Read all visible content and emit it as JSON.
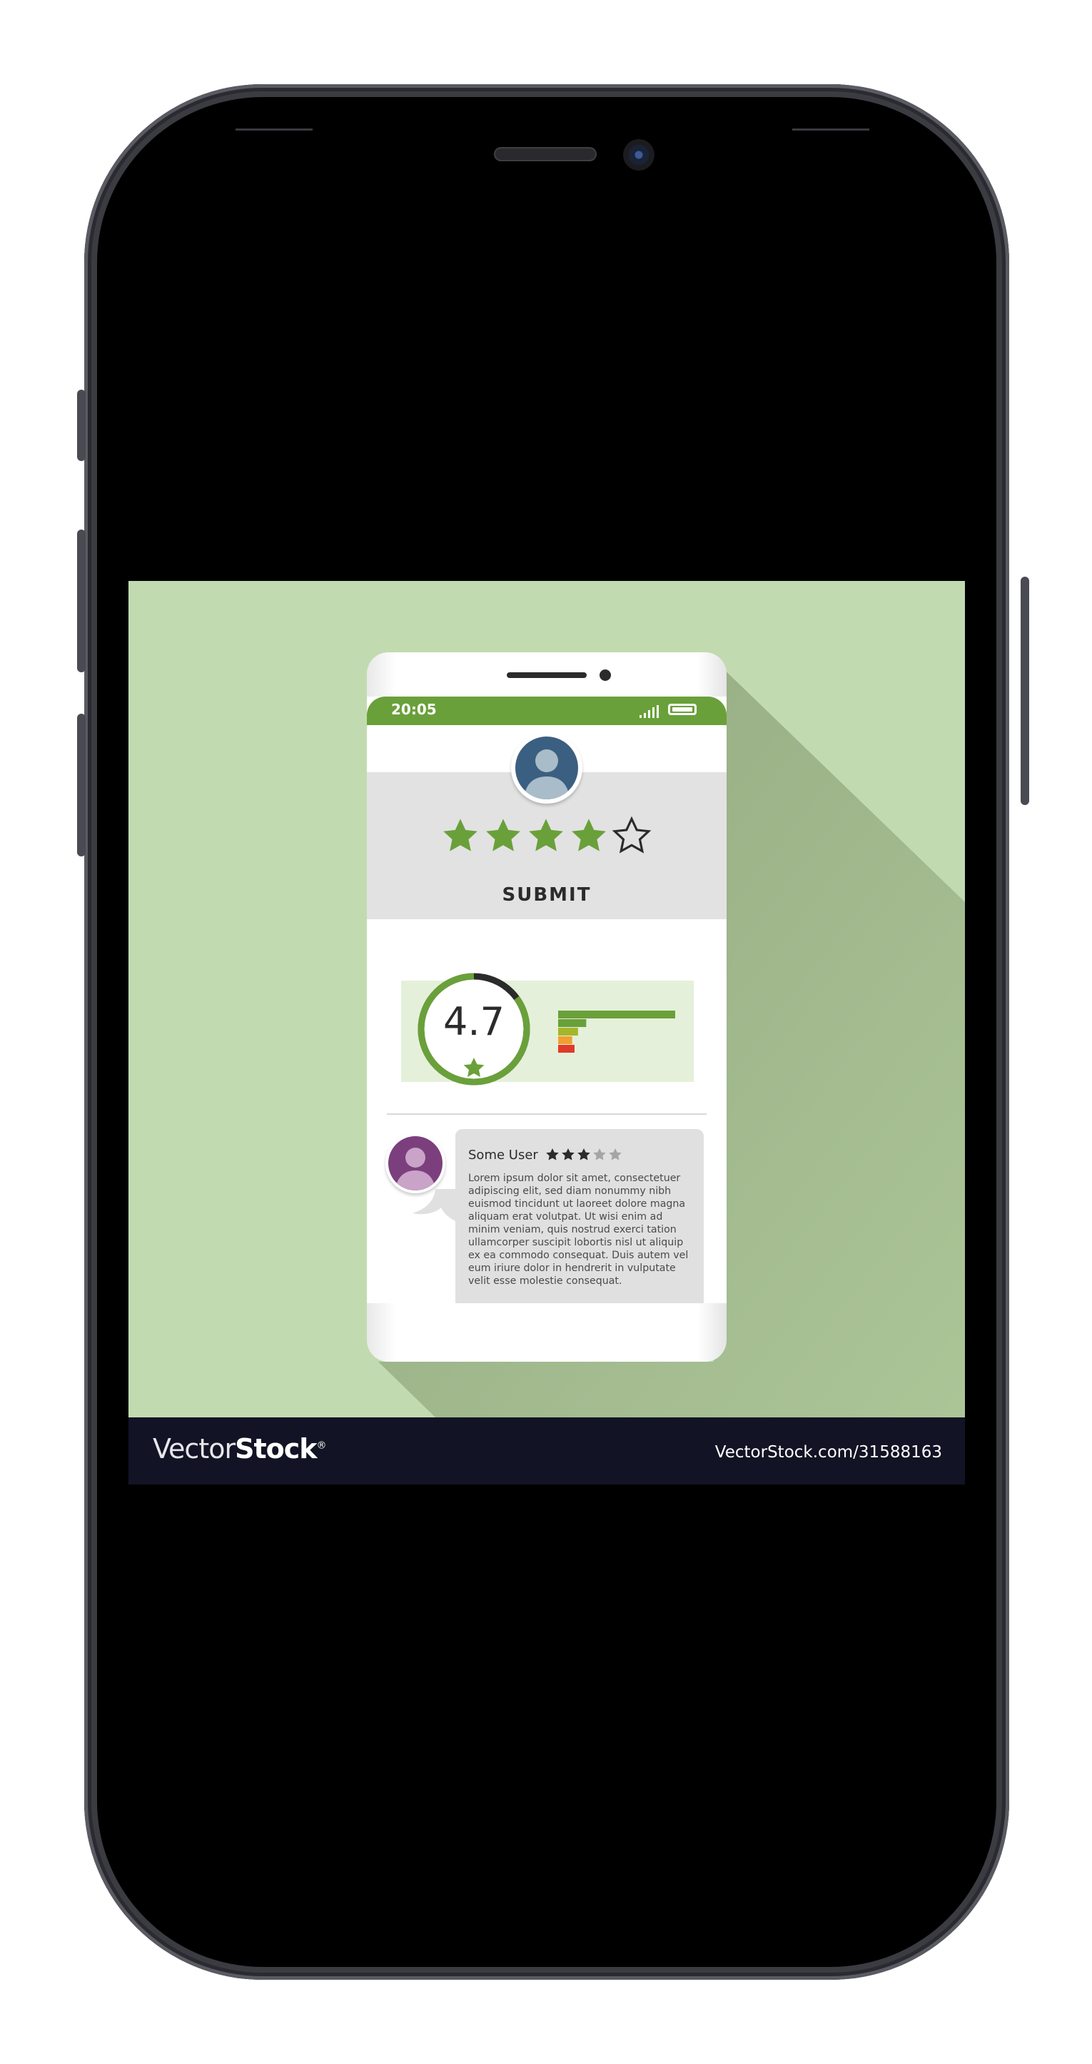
{
  "status_bar": {
    "time": "20:05"
  },
  "rating": {
    "selected_stars": 4,
    "max_stars": 5,
    "submit_label": "SUBMIT"
  },
  "score": {
    "value": "4.7",
    "ring_fraction": 0.85,
    "distribution": [
      {
        "stars": 5,
        "fraction": 1.0,
        "color": "#6aa03a"
      },
      {
        "stars": 4,
        "fraction": 0.24,
        "color": "#6aa03a"
      },
      {
        "stars": 3,
        "fraction": 0.17,
        "color": "#a6b62a"
      },
      {
        "stars": 2,
        "fraction": 0.12,
        "color": "#f0a030"
      },
      {
        "stars": 1,
        "fraction": 0.14,
        "color": "#e03a2a"
      }
    ]
  },
  "review": {
    "user_name": "Some User",
    "stars": 3,
    "max_stars": 5,
    "text": "Lorem ipsum dolor sit amet, consectetuer adipiscing elit, sed diam nonummy nibh euismod tincidunt ut laoreet dolore magna aliquam erat volutpat. Ut wisi enim ad minim veniam, quis nostrud exerci tation ullamcorper suscipit lobortis nisl ut aliquip ex ea commodo consequat. Duis autem vel eum iriure dolor in hendrerit in vulputate velit esse molestie consequat."
  },
  "footer": {
    "logo_light": "Vector",
    "logo_bold": "Stock",
    "logo_mark": "®",
    "url": "VectorStock.com/31588163"
  },
  "colors": {
    "accent_green": "#6aa03a",
    "background_green": "#c2dab0",
    "footer_navy": "#121425"
  }
}
